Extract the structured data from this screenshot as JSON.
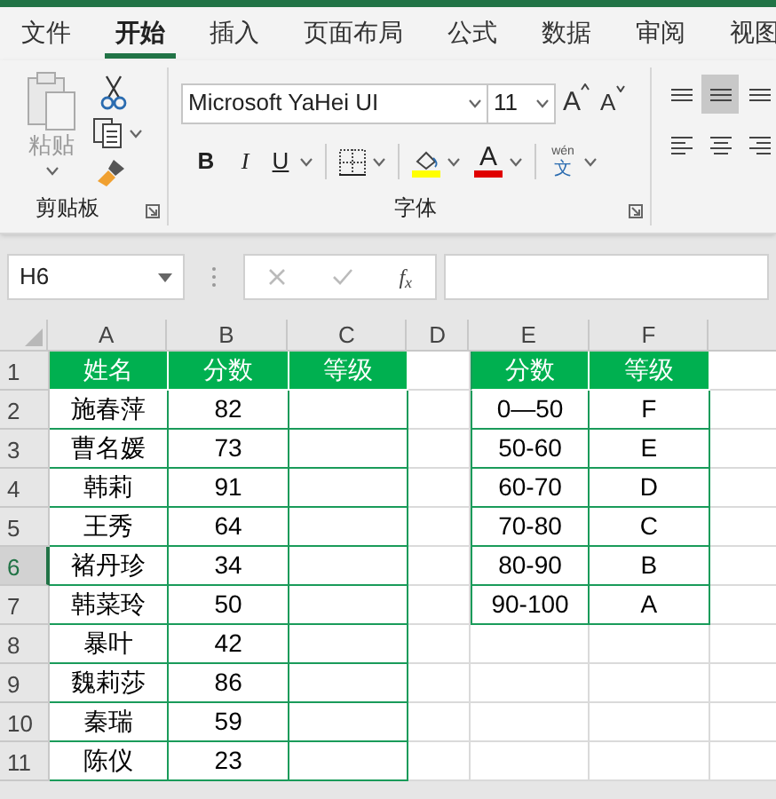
{
  "ribbon_tabs": [
    {
      "label": "文件",
      "selected": false
    },
    {
      "label": "开始",
      "selected": true
    },
    {
      "label": "插入",
      "selected": false
    },
    {
      "label": "页面布局",
      "selected": false
    },
    {
      "label": "公式",
      "selected": false
    },
    {
      "label": "数据",
      "selected": false
    },
    {
      "label": "审阅",
      "selected": false
    },
    {
      "label": "视图",
      "selected": false
    }
  ],
  "clipboard": {
    "paste_label": "粘贴",
    "group_label": "剪贴板"
  },
  "font": {
    "name": "Microsoft YaHei UI",
    "size": "11",
    "grow": "A",
    "shrink": "A",
    "bold": "B",
    "italic": "I",
    "underline": "U",
    "font_color_label": "A",
    "phonetic_top": "wén",
    "phonetic_bottom": "文",
    "group_label": "字体"
  },
  "alignment": {
    "buttons": [
      {
        "kind": "top",
        "selected": false
      },
      {
        "kind": "middle",
        "selected": true
      },
      {
        "kind": "bottom",
        "selected": false
      },
      {
        "kind": "left",
        "selected": false
      },
      {
        "kind": "center",
        "selected": false
      },
      {
        "kind": "right",
        "selected": false
      }
    ]
  },
  "name_box": {
    "value": "H6"
  },
  "formula_bar": {
    "fx": "f$_{x}$"
  },
  "sheet": {
    "columns": [
      {
        "label": "A",
        "selected": false
      },
      {
        "label": "B",
        "selected": false
      },
      {
        "label": "C",
        "selected": false
      },
      {
        "label": "D",
        "selected": false
      },
      {
        "label": "E",
        "selected": false
      },
      {
        "label": "F",
        "selected": false
      }
    ],
    "rows": [
      {
        "number": "1",
        "selected": false,
        "cells": [
          {
            "kind": "header",
            "text": "姓名"
          },
          {
            "kind": "header",
            "text": "分数"
          },
          {
            "kind": "header",
            "text": "等级"
          },
          null,
          {
            "kind": "header",
            "text": "分数"
          },
          {
            "kind": "header",
            "text": "等级"
          }
        ]
      },
      {
        "number": "2",
        "selected": false,
        "cells": [
          {
            "kind": "data",
            "text": "施春萍"
          },
          {
            "kind": "data",
            "text": "82"
          },
          {
            "kind": "data"
          },
          null,
          {
            "kind": "data",
            "text": "0—50"
          },
          {
            "kind": "data",
            "text": "F"
          }
        ]
      },
      {
        "number": "3",
        "selected": false,
        "cells": [
          {
            "kind": "data",
            "text": "曹名媛"
          },
          {
            "kind": "data",
            "text": "73"
          },
          {
            "kind": "data"
          },
          null,
          {
            "kind": "data",
            "text": "50-60"
          },
          {
            "kind": "data",
            "text": "E"
          }
        ]
      },
      {
        "number": "4",
        "selected": false,
        "cells": [
          {
            "kind": "data",
            "text": "韩莉"
          },
          {
            "kind": "data",
            "text": "91"
          },
          {
            "kind": "data"
          },
          null,
          {
            "kind": "data",
            "text": "60-70"
          },
          {
            "kind": "data",
            "text": "D"
          }
        ]
      },
      {
        "number": "5",
        "selected": false,
        "cells": [
          {
            "kind": "data",
            "text": "王秀"
          },
          {
            "kind": "data",
            "text": "64"
          },
          {
            "kind": "data"
          },
          null,
          {
            "kind": "data",
            "text": "70-80"
          },
          {
            "kind": "data",
            "text": "C"
          }
        ]
      },
      {
        "number": "6",
        "selected": true,
        "cells": [
          {
            "kind": "data",
            "text": "褚丹珍"
          },
          {
            "kind": "data",
            "text": "34"
          },
          {
            "kind": "data"
          },
          null,
          {
            "kind": "data",
            "text": "80-90"
          },
          {
            "kind": "data",
            "text": "B"
          }
        ]
      },
      {
        "number": "7",
        "selected": false,
        "cells": [
          {
            "kind": "data",
            "text": "韩菜玲"
          },
          {
            "kind": "data",
            "text": "50"
          },
          {
            "kind": "data"
          },
          null,
          {
            "kind": "data",
            "text": "90-100"
          },
          {
            "kind": "data",
            "text": "A"
          }
        ]
      },
      {
        "number": "8",
        "selected": false,
        "cells": [
          {
            "kind": "data",
            "text": "暴叶"
          },
          {
            "kind": "data",
            "text": "42"
          },
          {
            "kind": "data"
          },
          null,
          null,
          null
        ]
      },
      {
        "number": "9",
        "selected": false,
        "cells": [
          {
            "kind": "data",
            "text": "魏莉莎"
          },
          {
            "kind": "data",
            "text": "86"
          },
          {
            "kind": "data"
          },
          null,
          null,
          null
        ]
      },
      {
        "number": "10",
        "selected": false,
        "cells": [
          {
            "kind": "data",
            "text": "秦瑞"
          },
          {
            "kind": "data",
            "text": "59"
          },
          {
            "kind": "data"
          },
          null,
          null,
          null
        ]
      },
      {
        "number": "11",
        "selected": false,
        "cells": [
          {
            "kind": "data",
            "text": "陈仪"
          },
          {
            "kind": "data",
            "text": "23"
          },
          {
            "kind": "data"
          },
          null,
          null,
          null
        ]
      }
    ]
  }
}
